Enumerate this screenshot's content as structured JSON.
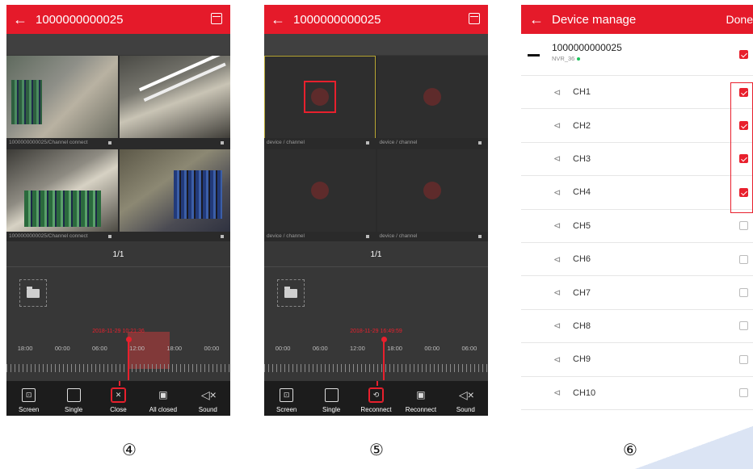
{
  "colors": {
    "accent": "#e51a2a"
  },
  "screens": [
    {
      "title": "1000000000025",
      "page": "1/1",
      "timestamp": "2018-11-29 10:21:36",
      "time_ticks": [
        "18:00",
        "00:00",
        "06:00",
        "12:00",
        "18:00",
        "00:00"
      ],
      "cells": [
        {
          "label": "1000000000025/Channel connect"
        },
        {
          "label": ""
        },
        {
          "label": "1000000000025/Channel connect"
        },
        {
          "label": ""
        }
      ],
      "toolbar": [
        {
          "label": "Screen",
          "icon": "screen-icon"
        },
        {
          "label": "Single",
          "icon": "single-window-icon"
        },
        {
          "label": "Close",
          "icon": "close-window-icon"
        },
        {
          "label": "All closed",
          "icon": "all-closed-icon"
        },
        {
          "label": "Sound",
          "icon": "sound-mute-icon"
        }
      ]
    },
    {
      "title": "1000000000025",
      "page": "1/1",
      "timestamp": "2018-11-29 16:49:59",
      "time_ticks": [
        "00:00",
        "06:00",
        "12:00",
        "18:00",
        "00:00",
        "06:00"
      ],
      "cells": [
        {
          "label": "device / channel"
        },
        {
          "label": "device / channel"
        },
        {
          "label": "device / channel"
        },
        {
          "label": "device / channel"
        }
      ],
      "toolbar": [
        {
          "label": "Screen",
          "icon": "screen-icon"
        },
        {
          "label": "Single",
          "icon": "single-window-icon"
        },
        {
          "label": "Reconnect",
          "icon": "reconnect-icon"
        },
        {
          "label": "Reconnect",
          "icon": "reconnect-all-icon"
        },
        {
          "label": "Sound",
          "icon": "sound-mute-icon"
        }
      ]
    }
  ],
  "device_manage": {
    "title": "Device manage",
    "done": "Done",
    "device": {
      "name": "1000000000025",
      "sub": "NVR_36",
      "checked": true
    },
    "channels": [
      {
        "name": "CH1",
        "checked": true
      },
      {
        "name": "CH2",
        "checked": true
      },
      {
        "name": "CH3",
        "checked": true
      },
      {
        "name": "CH4",
        "checked": true
      },
      {
        "name": "CH5",
        "checked": false
      },
      {
        "name": "CH6",
        "checked": false
      },
      {
        "name": "CH7",
        "checked": false
      },
      {
        "name": "CH8",
        "checked": false
      },
      {
        "name": "CH9",
        "checked": false
      },
      {
        "name": "CH10",
        "checked": false
      }
    ]
  },
  "step_numbers": [
    "④",
    "⑤",
    "⑥"
  ]
}
